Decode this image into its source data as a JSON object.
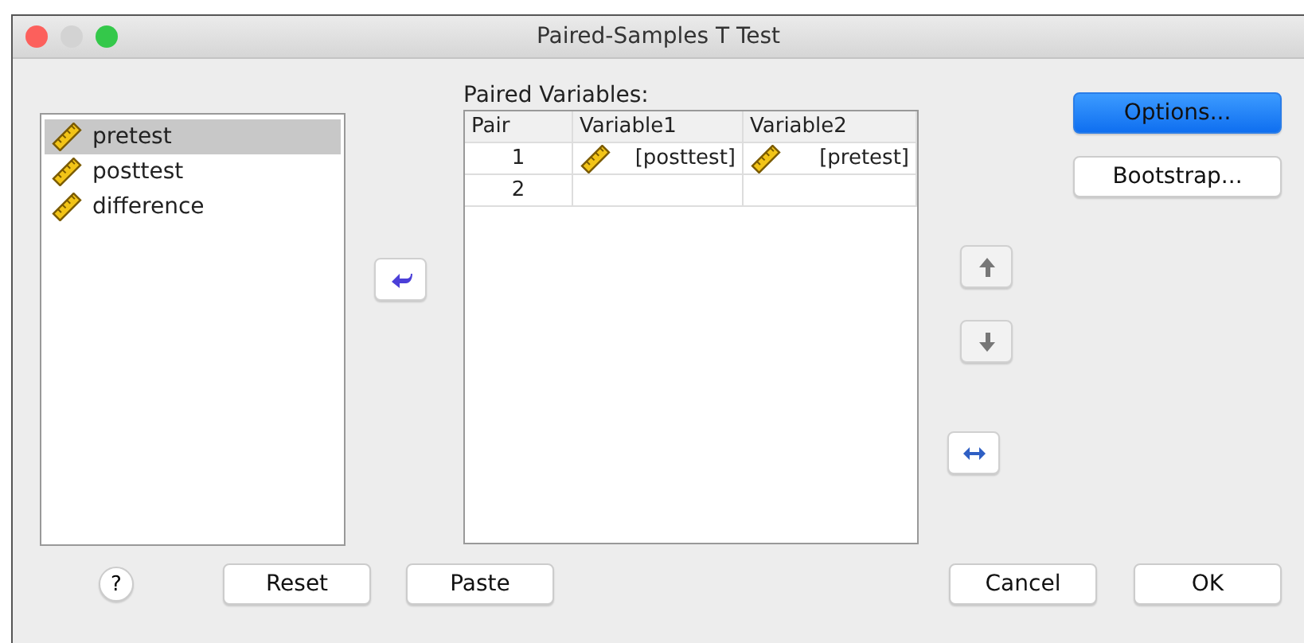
{
  "window": {
    "title": "Paired-Samples T Test"
  },
  "variables": [
    {
      "name": "pretest",
      "selected": true
    },
    {
      "name": "posttest",
      "selected": false
    },
    {
      "name": "difference",
      "selected": false
    }
  ],
  "paired": {
    "label": "Paired Variables:",
    "columns": [
      "Pair",
      "Variable1",
      "Variable2"
    ],
    "rows": [
      {
        "pair": "1",
        "variable1": "[posttest]",
        "variable2": "[pretest]"
      },
      {
        "pair": "2"
      }
    ]
  },
  "move_buttons": [
    {
      "kind": "up",
      "disabled": true
    },
    {
      "kind": "down",
      "disabled": true
    },
    {
      "kind": "swap",
      "disabled": false
    }
  ],
  "side_buttons": [
    {
      "label": "Options...",
      "default": true
    },
    {
      "label": "Bootstrap...",
      "default": false
    }
  ],
  "bottom_left": {
    "help": "?",
    "buttons": [
      "Reset",
      "Paste"
    ]
  },
  "bottom_right": [
    "Cancel",
    "OK"
  ]
}
